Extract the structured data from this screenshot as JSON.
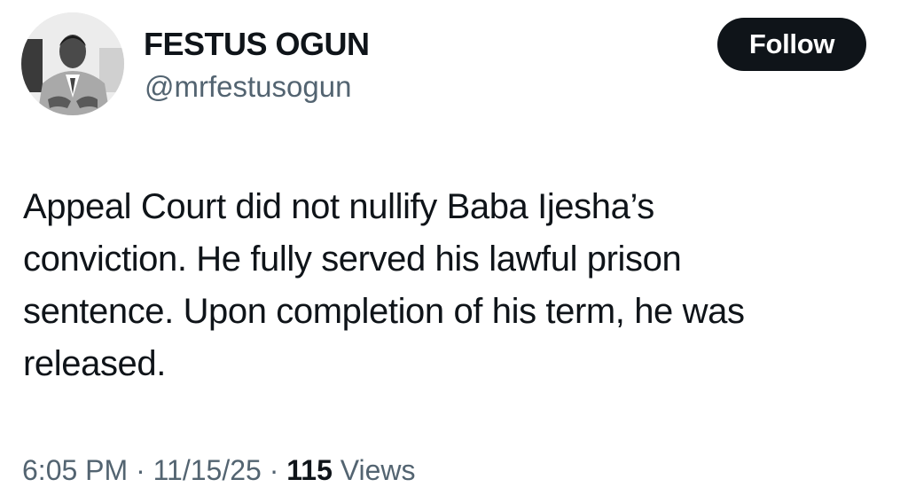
{
  "author": {
    "name": "FESTUS OGUN",
    "handle": "@mrfestusogun",
    "avatar_icon": "profile-photo-icon"
  },
  "follow_button": {
    "label": "Follow"
  },
  "tweet": {
    "text": "Appeal Court did not nullify Baba Ijesha’s\nconviction. He fully served his lawful prison\nsentence. Upon completion of his term, he was\nreleased."
  },
  "meta": {
    "time": "6:05 PM",
    "separator": " · ",
    "date": "11/15/25",
    "views_count": "115",
    "views_label": " Views"
  },
  "colors": {
    "text_primary": "#0f1419",
    "text_secondary": "#536471",
    "button_bg": "#0f1419",
    "button_text": "#ffffff"
  }
}
